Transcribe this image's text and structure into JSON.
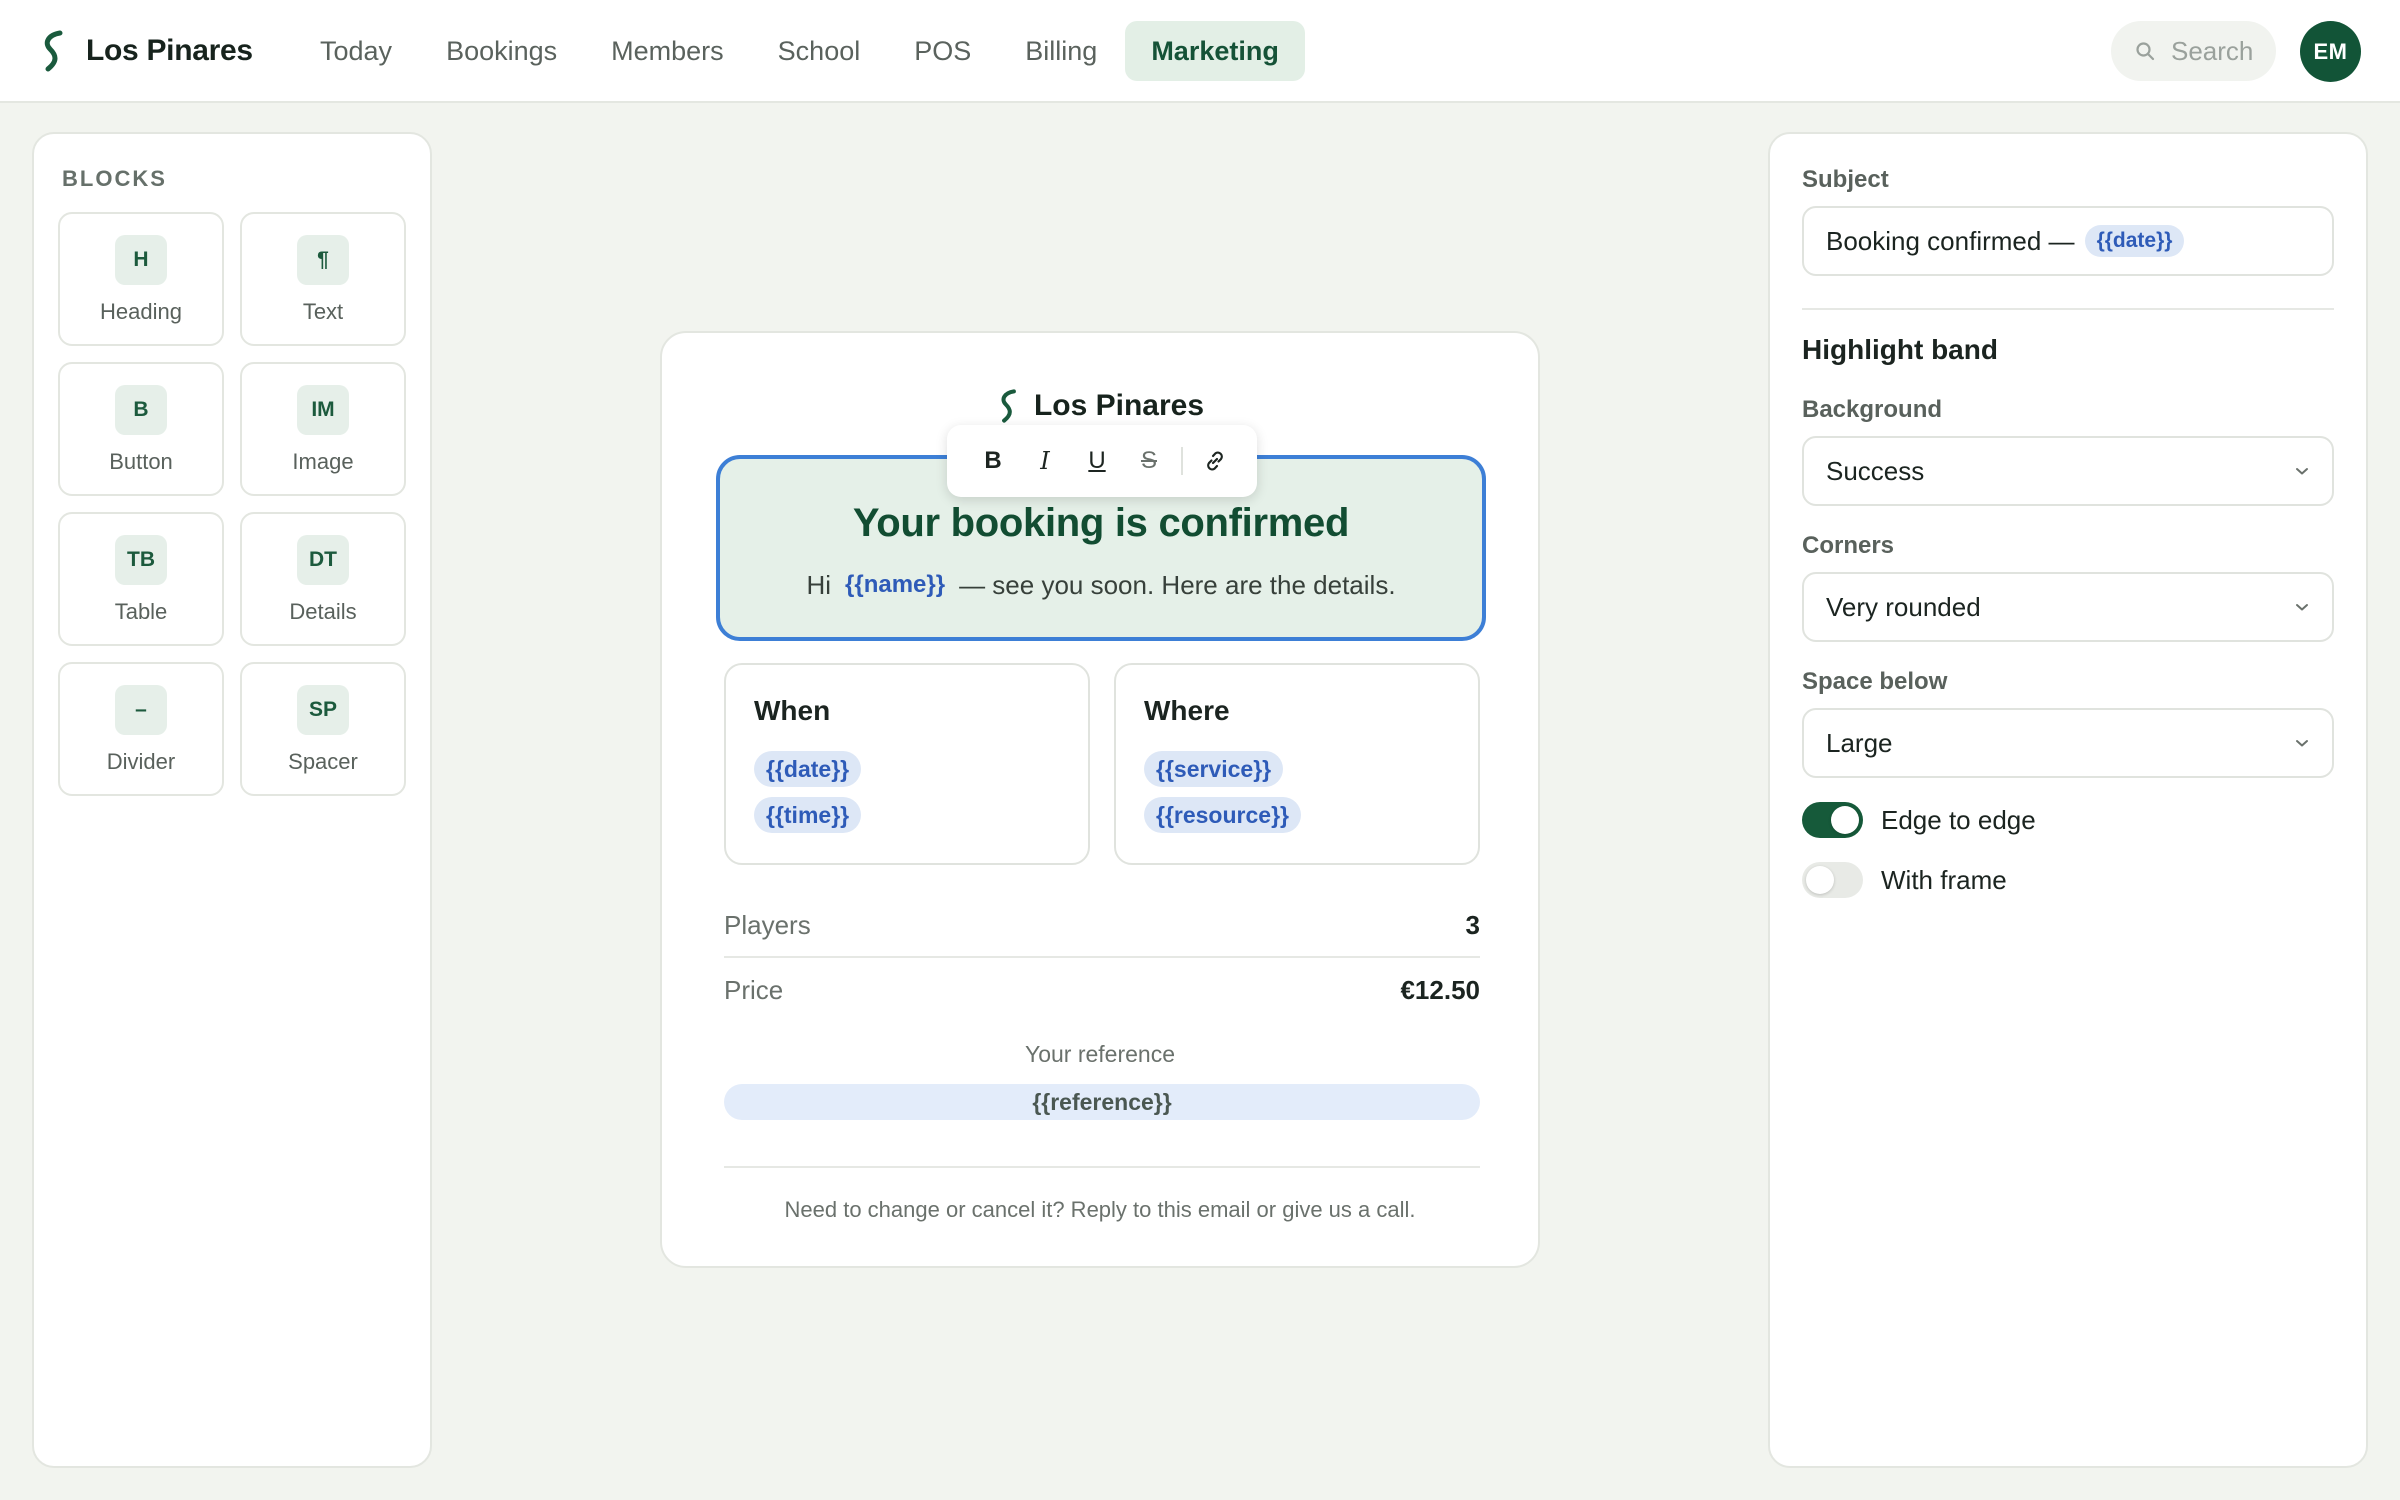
{
  "app": {
    "brand": "Los Pinares",
    "user_initials": "EM"
  },
  "nav": {
    "items": [
      {
        "label": "Today"
      },
      {
        "label": "Bookings"
      },
      {
        "label": "Members"
      },
      {
        "label": "School"
      },
      {
        "label": "POS"
      },
      {
        "label": "Billing"
      },
      {
        "label": "Marketing",
        "active": true
      }
    ],
    "search_placeholder": "Search"
  },
  "blocks": {
    "title": "BLOCKS",
    "items": [
      {
        "badge": "H",
        "label": "Heading"
      },
      {
        "badge": "¶",
        "label": "Text"
      },
      {
        "badge": "B",
        "label": "Button"
      },
      {
        "badge": "IM",
        "label": "Image"
      },
      {
        "badge": "TB",
        "label": "Table"
      },
      {
        "badge": "DT",
        "label": "Details"
      },
      {
        "badge": "–",
        "label": "Divider"
      },
      {
        "badge": "SP",
        "label": "Spacer"
      }
    ]
  },
  "email": {
    "brand": "Los Pinares",
    "band": {
      "title": "Your booking is confirmed",
      "greeting": "Hi",
      "name_token": "{{name}}",
      "rest": "— see you soon. Here are the details."
    },
    "format_toolbar": {
      "bold": "B",
      "italic": "I",
      "underline": "U",
      "strike": "S"
    },
    "when": {
      "title": "When",
      "tokens": [
        "{{date}}",
        "{{time}}"
      ]
    },
    "where": {
      "title": "Where",
      "tokens": [
        "{{service}}",
        "{{resource}}"
      ]
    },
    "rows": [
      {
        "label": "Players",
        "value": "3"
      },
      {
        "label": "Price",
        "value": "€12.50"
      }
    ],
    "reference_label": "Your reference",
    "reference_token": "{{reference}}",
    "footer": "Need to change or cancel it? Reply to this email or give us a call."
  },
  "settings": {
    "subject_label": "Subject",
    "subject_text": "Booking confirmed —",
    "subject_token": "{{date}}",
    "section_title": "Highlight band",
    "background_label": "Background",
    "background_value": "Success",
    "corners_label": "Corners",
    "corners_value": "Very rounded",
    "space_label": "Space below",
    "space_value": "Large",
    "toggles": [
      {
        "label": "Edge to edge",
        "on": true
      },
      {
        "label": "With frame",
        "on": false
      }
    ]
  },
  "colors": {
    "brand_green": "#125437",
    "selection_blue": "#3d7fd6",
    "token_blue": "#2e5bb8",
    "band_bg": "#e5f0e8"
  }
}
